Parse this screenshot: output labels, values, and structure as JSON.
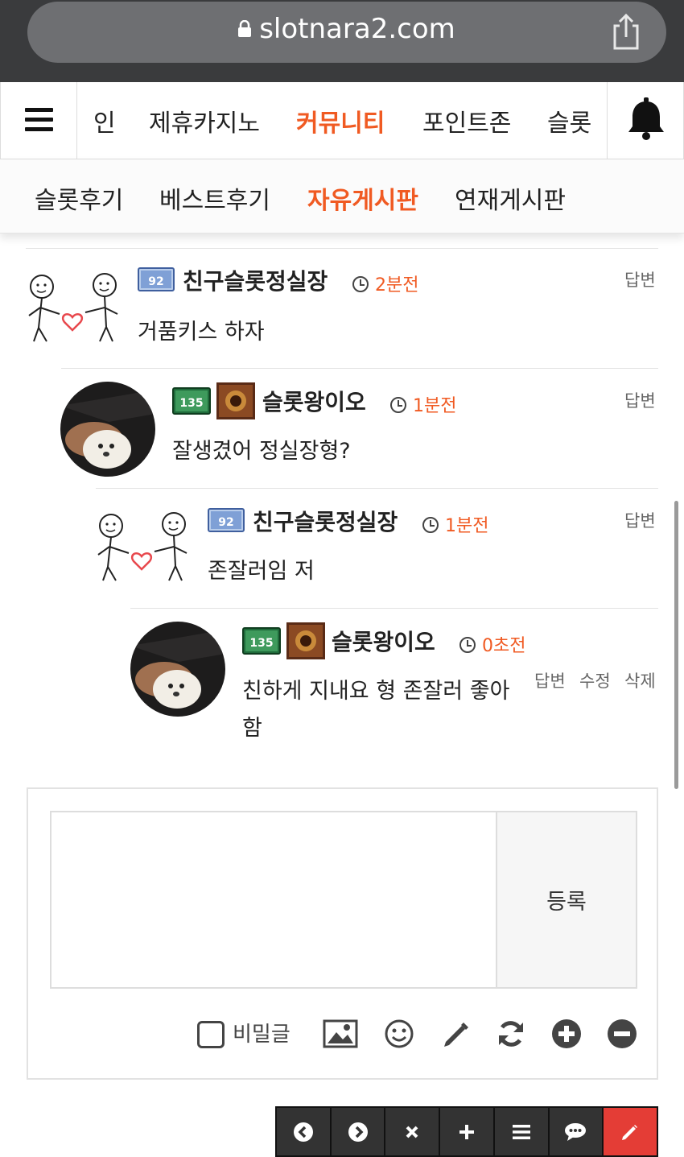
{
  "browser": {
    "url": "slotnara2.com"
  },
  "main_nav": {
    "items": [
      "인",
      "제휴카지노",
      "커뮤니티",
      "포인트존",
      "슬롯"
    ],
    "active": "커뮤니티"
  },
  "sub_nav": {
    "items": [
      "슬롯후기",
      "베스트후기",
      "자유게시판",
      "연재게시판"
    ],
    "active": "자유게시판"
  },
  "comments": [
    {
      "author": "친구슬롯정실장",
      "level": "92",
      "time": "2분전",
      "text": "거품키스 하자",
      "actions": [
        "답변"
      ]
    },
    {
      "author": "슬롯왕이오",
      "level": "135",
      "time": "1분전",
      "text": "잘생겼어 정실장형?",
      "actions": [
        "답변"
      ]
    },
    {
      "author": "친구슬롯정실장",
      "level": "92",
      "time": "1분전",
      "text": "존잘러임 저",
      "actions": [
        "답변"
      ]
    },
    {
      "author": "슬롯왕이오",
      "level": "135",
      "time": "0초전",
      "text_line1": "친하게 지내요 형 존잘러 좋아",
      "text_line2": "함",
      "actions": [
        "답변",
        "수정",
        "삭제"
      ]
    }
  ],
  "write_form": {
    "submit_label": "등록",
    "secret_label": "비밀글",
    "tool_icons": [
      "image-icon",
      "smile-icon",
      "pencil-icon",
      "refresh-icon",
      "plus-circle-icon",
      "minus-circle-icon"
    ]
  },
  "bottom_toolbar": {
    "buttons": [
      "prev-icon",
      "next-icon",
      "close-icon",
      "plus-icon",
      "list-icon",
      "comment-icon",
      "write-icon"
    ],
    "accent_color": "#e43d36"
  },
  "colors": {
    "accent": "#f05a22",
    "browser_bar": "#3a3b3d"
  }
}
